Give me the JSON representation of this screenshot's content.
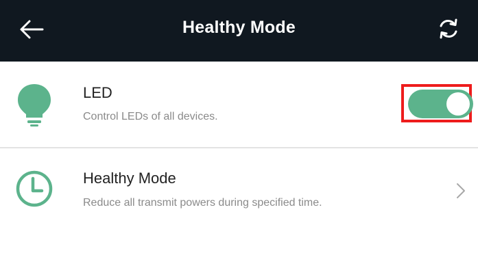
{
  "header": {
    "title": "Healthy Mode",
    "back_icon": "arrow-left-icon",
    "refresh_icon": "refresh-icon"
  },
  "items": [
    {
      "icon": "lightbulb-icon",
      "title": "LED",
      "description": "Control LEDs of all devices.",
      "control": "toggle",
      "toggle_on": true
    },
    {
      "icon": "clock-icon",
      "title": "Healthy Mode",
      "description": "Reduce all transmit powers during specified time.",
      "control": "chevron-right-icon"
    }
  ],
  "colors": {
    "header_bg": "#101820",
    "accent_green": "#5cb38c",
    "highlight_red": "#ee1c1c"
  }
}
